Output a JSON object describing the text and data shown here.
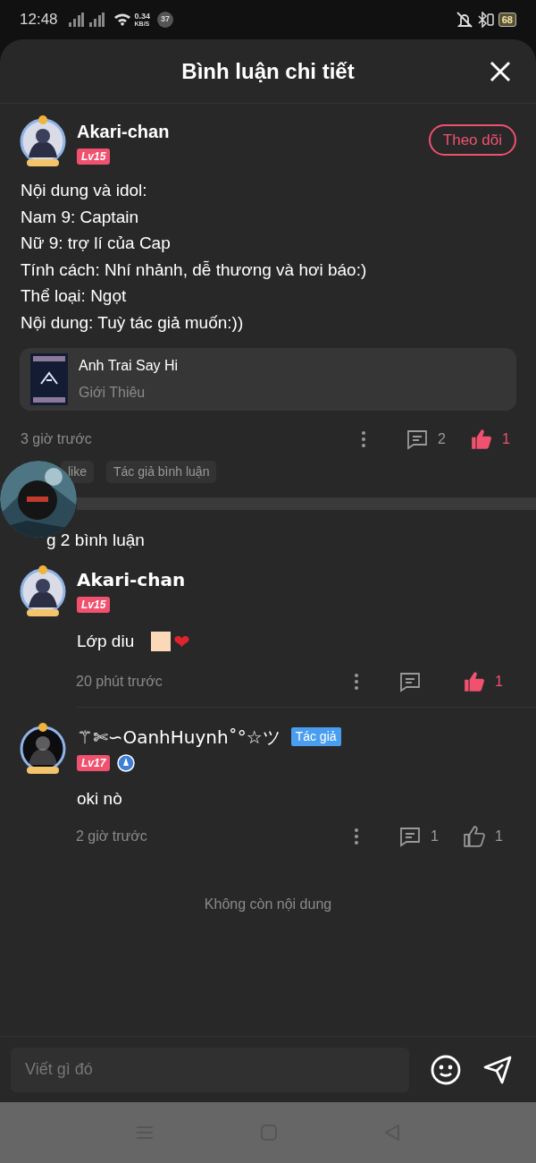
{
  "status_bar": {
    "time": "12:48",
    "net_speed": "0.34",
    "net_unit": "KB/S",
    "notification_count": "37",
    "battery": "68"
  },
  "header": {
    "title": "Bình luận chi tiết"
  },
  "post": {
    "author": "Akari-chan",
    "level": "Lv15",
    "follow_label": "Theo dõi",
    "lines": [
      "Nội dung và idol:",
      "Nam 9: Captain",
      "Nữ 9: trợ lí của Cap",
      "Tính cách: Nhí nhảnh, dễ thương và hơi báo:)",
      "Thể loại: Ngọt",
      "Nội dung: Tuỳ tác giả muốn:))"
    ],
    "book": {
      "title": "Anh Trai Say Hi",
      "subtitle": "Giới Thiêu"
    },
    "time": "3 giờ trước",
    "comment_count": "2",
    "like_count": "1",
    "liked": true,
    "tags": [
      "like",
      "Tác giả bình luận"
    ]
  },
  "total_label": "g 2 bình luận",
  "comments": [
    {
      "author": "Akari-chan",
      "level": "Lv15",
      "verified": false,
      "text": "Lớp diu",
      "emoji": "❤",
      "time": "20 phút trước",
      "like_count": "1",
      "liked": true
    },
    {
      "author": "⚚✄∽OanhHuynh˚°☆ツ",
      "level": "Lv17",
      "author_badge": "Tác giả",
      "verified": true,
      "text": "oki nò",
      "time": "2 giờ trước",
      "comment_count": "1",
      "like_count": "1",
      "liked": false
    }
  ],
  "end_label": "Không còn nội dung",
  "input": {
    "placeholder": "Viết gì đó"
  }
}
